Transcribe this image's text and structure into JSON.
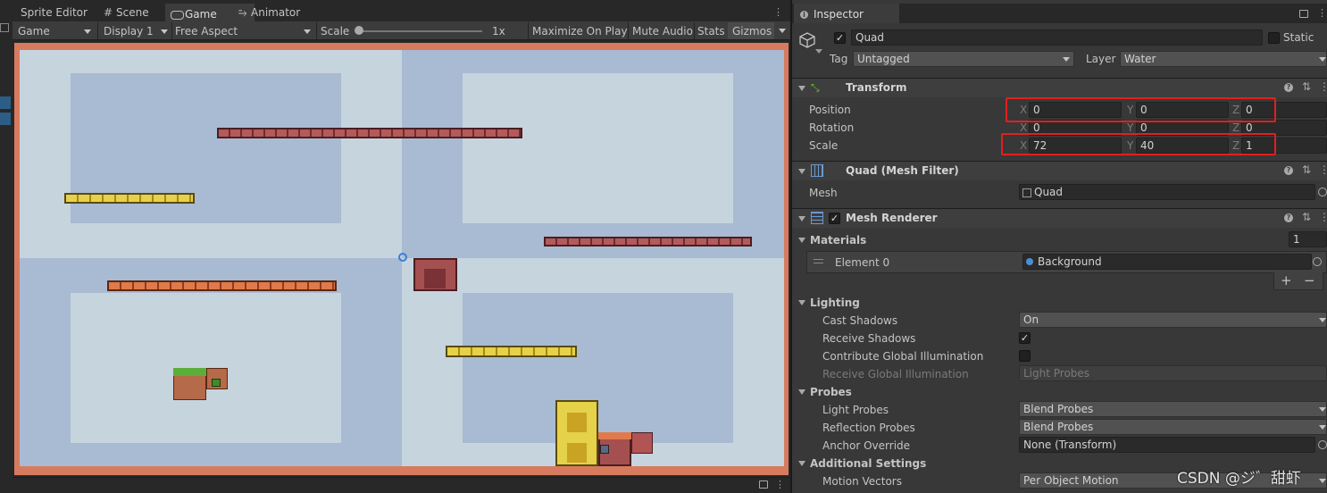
{
  "game_panel": {
    "tabs": [
      {
        "label": "Sprite Editor"
      },
      {
        "label": "Scene"
      },
      {
        "label": "Game"
      },
      {
        "label": "Animator"
      }
    ],
    "toolbar": {
      "view_select": "Game",
      "display_select": "Display 1",
      "aspect_select": "Free Aspect",
      "scale_label": "Scale",
      "scale_value": "1x",
      "scale_slider_fraction": 0.0,
      "maximize_label": "Maximize On Play",
      "mute_label": "Mute Audio",
      "stats_label": "Stats",
      "gizmos_label": "Gizmos"
    }
  },
  "inspector": {
    "tab_label": "Inspector",
    "object": {
      "active": true,
      "name": "Quad",
      "static_label": "Static",
      "tag_label": "Tag",
      "tag_value": "Untagged",
      "layer_label": "Layer",
      "layer_value": "Water"
    },
    "transform": {
      "title": "Transform",
      "position_label": "Position",
      "rotation_label": "Rotation",
      "scale_label": "Scale",
      "axis_x": "X",
      "axis_y": "Y",
      "axis_z": "Z",
      "position": {
        "x": "0",
        "y": "0",
        "z": "0"
      },
      "rotation": {
        "x": "0",
        "y": "0",
        "z": "0"
      },
      "scale": {
        "x": "72",
        "y": "40",
        "z": "1"
      }
    },
    "mesh_filter": {
      "title": "Quad (Mesh Filter)",
      "mesh_label": "Mesh",
      "mesh_value": "Quad"
    },
    "mesh_renderer": {
      "enabled": true,
      "title": "Mesh Renderer",
      "materials_label": "Materials",
      "materials_count": "1",
      "element_label": "Element 0",
      "element_value": "Background",
      "plus": "+",
      "minus": "−",
      "lighting_label": "Lighting",
      "cast_shadows_label": "Cast Shadows",
      "cast_shadows_value": "On",
      "receive_shadows_label": "Receive Shadows",
      "receive_shadows_checked": true,
      "contribute_gi_label": "Contribute Global Illumination",
      "contribute_gi_checked": false,
      "receive_gi_label": "Receive Global Illumination",
      "receive_gi_value": "Light Probes",
      "probes_label": "Probes",
      "light_probes_label": "Light Probes",
      "light_probes_value": "Blend Probes",
      "reflection_probes_label": "Reflection Probes",
      "reflection_probes_value": "Blend Probes",
      "anchor_override_label": "Anchor Override",
      "anchor_override_value": "None (Transform)",
      "additional_label": "Additional Settings",
      "motion_vectors_label": "Motion Vectors",
      "motion_vectors_value": "Per Object Motion"
    }
  },
  "watermark": "CSDN @ジ゛甜虾",
  "colors": {
    "editor_bg": "#383838",
    "highlight_red": "#e0201e",
    "sky_light": "#c6d4de",
    "sky_dark": "#a9bbd2"
  }
}
